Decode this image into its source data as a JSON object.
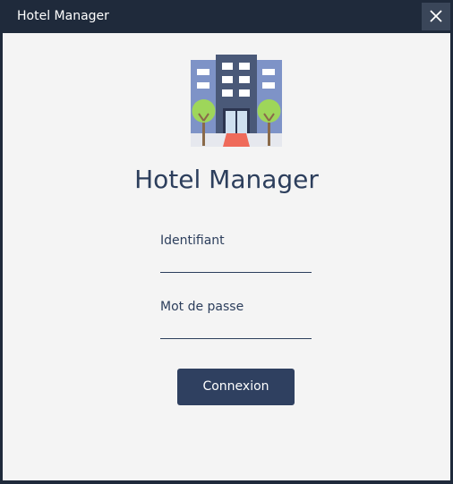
{
  "window": {
    "title": "Hotel Manager",
    "close_icon": "close-icon"
  },
  "logo": {
    "icon": "hotel-building-icon"
  },
  "login": {
    "heading": "Hotel Manager",
    "username_label": "Identifiant",
    "username_value": "",
    "password_label": "Mot de passe",
    "password_value": "",
    "submit_label": "Connexion"
  },
  "colors": {
    "titlebar": "#1f2a3b",
    "background": "#f4f4f4",
    "accent": "#2f4060",
    "text": "#2c3e5c"
  }
}
